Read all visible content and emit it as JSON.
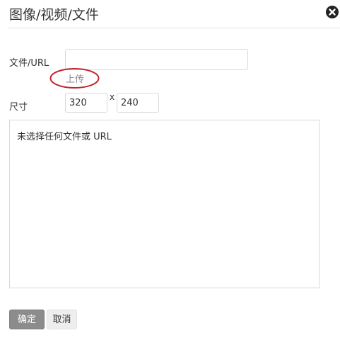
{
  "dialog": {
    "title": "图像/视频/文件",
    "close_icon": "close-icon"
  },
  "form": {
    "url_label": "文件/URL",
    "url_value": "",
    "upload_label": "上传",
    "size_label": "尺寸",
    "width_value": "320",
    "times_sign": "x",
    "height_value": "240"
  },
  "preview": {
    "message": "未选择任何文件或 URL"
  },
  "buttons": {
    "ok_label": "确定",
    "cancel_label": "取消"
  },
  "colors": {
    "annotation_oval": "#c0262b",
    "ok_button": "#8c8c8c"
  }
}
